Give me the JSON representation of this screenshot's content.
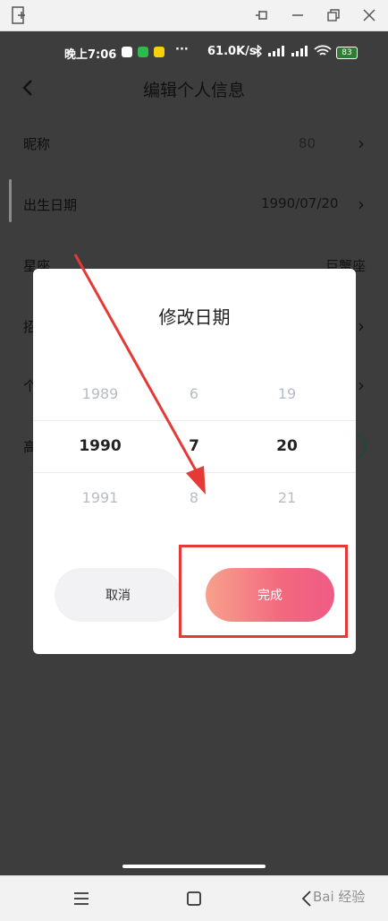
{
  "status_bar": {
    "time": "晚上7:06",
    "net_speed": "61.0K/s",
    "more": "···",
    "battery": "83"
  },
  "header": {
    "title": "编辑个人信息"
  },
  "rows": [
    {
      "label": "昵称",
      "value": "80"
    },
    {
      "label": "出生日期",
      "value": "1990/07/20"
    },
    {
      "label": "星座",
      "value": "巨蟹座"
    },
    {
      "label": "招",
      "value": ""
    },
    {
      "label": "个",
      "value": ""
    },
    {
      "label": "高",
      "value": ""
    }
  ],
  "dialog": {
    "title": "修改日期",
    "columns": {
      "year": [
        "1989",
        "1990",
        "1991"
      ],
      "month": [
        "6",
        "7",
        "8"
      ],
      "day": [
        "19",
        "20",
        "21"
      ]
    },
    "cancel_label": "取消",
    "done_label": "完成"
  },
  "watermark": "Bai 经验"
}
